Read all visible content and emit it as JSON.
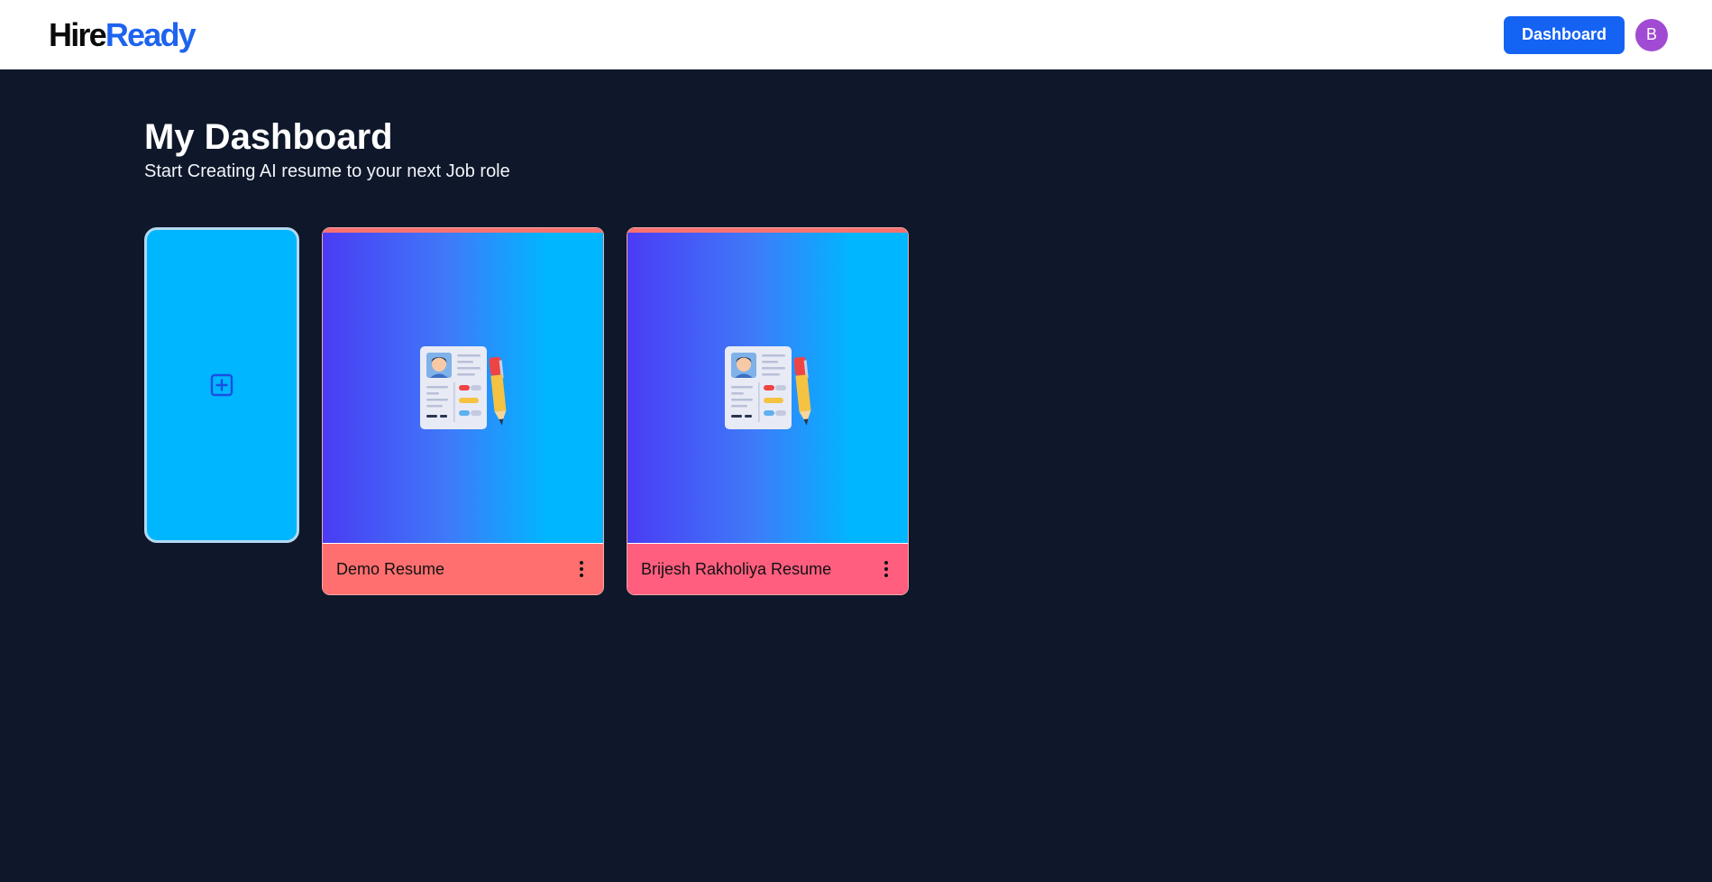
{
  "header": {
    "logo_part_a": "Hire",
    "logo_part_b": "Ready",
    "dashboard_button": "Dashboard",
    "avatar_initial": "B"
  },
  "main": {
    "title": "My Dashboard",
    "subtitle": "Start Creating AI resume to your next Job role"
  },
  "add_card": {
    "icon": "plus-square-icon"
  },
  "resumes": [
    {
      "title": "Demo Resume",
      "footer_color": "#ff6f6f",
      "icon": "resume-pen-icon"
    },
    {
      "title": "Brijesh Rakholiya Resume",
      "footer_color": "#ff5e7f",
      "icon": "resume-pen-icon"
    }
  ],
  "colors": {
    "background": "#0f172a",
    "accent": "#1463f3",
    "add_card": "#00b6ff",
    "thumb_gradient_start": "#4a3cf4",
    "thumb_gradient_end": "#00b6ff"
  }
}
